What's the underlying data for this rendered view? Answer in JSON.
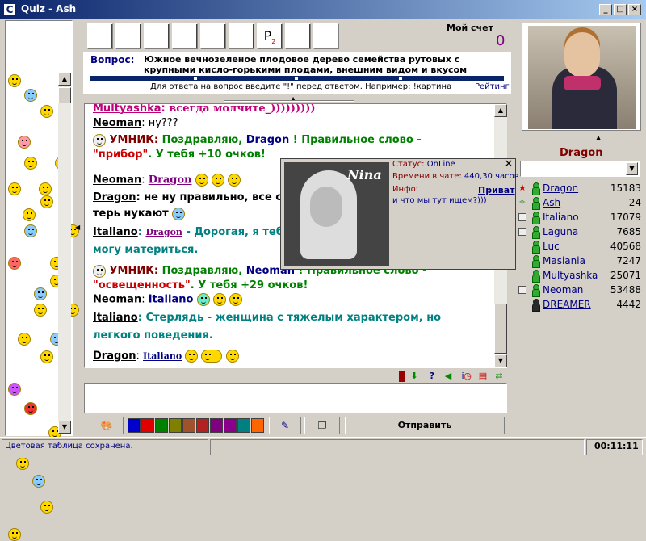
{
  "window": {
    "title": "Quiz - Ash",
    "app_icon": "C"
  },
  "game": {
    "letters": [
      "",
      "",
      "",
      "",
      "",
      "",
      "P",
      "",
      ""
    ],
    "letter_sub": "2",
    "score_label": "Мой счет",
    "score": "0",
    "question_label": "Вопрос:",
    "question_text": "Южное вечнозеленое плодовое дерево семейства рутовых с крупными кисло-горькими плодами, внешним видом и вкусом",
    "hint": "Для ответа на вопрос введите \"!\" перед ответом. Например: !картина",
    "rating_link": "Рейтинг"
  },
  "chat": {
    "msg1_nick": "Multyashka",
    "msg1_text": "всегда молчите_)))))))))",
    "msg2_nick": "Neoman",
    "msg2_text": "ну???",
    "bot1_name": "УМНИК:",
    "bot1_text_a": "Поздравляю,",
    "bot1_winner": "Dragon",
    "bot1_text_b": "! Правильное слово -",
    "bot1_word": "\"прибор\"",
    "bot1_text_c": ". У тебя +10 очков!",
    "msg3_nick": "Neoman",
    "msg3_to": "Dragon",
    "msg4_nick": "Dragon",
    "msg4_text_a": "не ну правильно, все сле",
    "msg4_text_b": "терь нукают",
    "msg5_nick": "Italiano",
    "msg5_to": "Dragon",
    "msg5_text_a": "- Дорогая, я тебе",
    "msg5_text_b": "могу материться.",
    "bot2_name": "УМНИК:",
    "bot2_text_a": "Поздравляю,",
    "bot2_winner": "Neoman",
    "bot2_text_b": "! Правильное слово -",
    "bot2_word": "\"освещенность\"",
    "bot2_text_c": ". У тебя +29 очков!",
    "msg6_nick": "Neoman",
    "msg6_to": "Italiano",
    "msg7_nick": "Italiano",
    "msg7_text_a": "Стерлядь - женщина с тяжелым характером, но",
    "msg7_text_b": "легкого поведения.",
    "msg8_nick": "Dragon",
    "msg8_to": "Italiano"
  },
  "popup": {
    "status_label": "Статус:",
    "status_value": "OnLine",
    "time_label": "Времени в чате:",
    "time_value": "440,30 часов",
    "info_label": "Инфо:",
    "private_link": "Приват",
    "info_text": "и что мы тут ищем?)))",
    "photo_caption": "Nina"
  },
  "profile": {
    "name": "Dragon"
  },
  "users": [
    {
      "name": "Dragon",
      "score": "15183",
      "linked": true,
      "mark": "star"
    },
    {
      "name": "Ash",
      "score": "24",
      "linked": true,
      "mark": "sparkle"
    },
    {
      "name": "Italiano",
      "score": "17079",
      "linked": false,
      "mark": "box"
    },
    {
      "name": "Laguna",
      "score": "7685",
      "linked": false,
      "mark": "box"
    },
    {
      "name": "Luc",
      "score": "40568",
      "linked": false,
      "mark": ""
    },
    {
      "name": "Masiania",
      "score": "7247",
      "linked": false,
      "mark": ""
    },
    {
      "name": "Multyashka",
      "score": "25071",
      "linked": false,
      "mark": ""
    },
    {
      "name": "Neoman",
      "score": "53488",
      "linked": false,
      "mark": "box"
    },
    {
      "name": "DREAMER",
      "score": "4442",
      "linked": true,
      "mark": "skull"
    }
  ],
  "toolbar": {
    "send_label": "Отправить"
  },
  "palette": [
    "#0000cc",
    "#e00000",
    "#008000",
    "#808000",
    "#a0522d",
    "#b22222",
    "#800080",
    "#8b008b",
    "#008080",
    "#ff6600"
  ],
  "status": {
    "text": "Цветовая таблица сохранена.",
    "clock": "00:11:11"
  }
}
